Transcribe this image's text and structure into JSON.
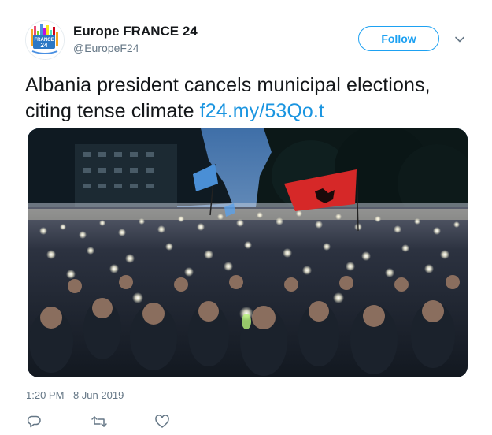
{
  "author": {
    "name": "Europe FRANCE 24",
    "handle": "@EuropeF24",
    "avatar_text_1": "FRANCE",
    "avatar_text_2": "24",
    "avatar_icon": "france24-europe-logo"
  },
  "header": {
    "follow_label": "Follow",
    "menu_icon": "chevron-down-icon"
  },
  "tweet": {
    "text": "Albania president cancels municipal elections, citing tense climate ",
    "link": "f24.my/53Qo.t",
    "media_description_icon": "photo"
  },
  "meta": {
    "timestamp": "1:20 PM - 8 Jun 2019"
  },
  "actions": {
    "reply_icon": "reply-icon",
    "retweet_icon": "retweet-icon",
    "like_icon": "heart-icon"
  },
  "colors": {
    "accent": "#1da1f2",
    "link": "#1b95e0",
    "muted": "#657786",
    "text": "#14171a",
    "flag_red": "#d62828",
    "flag_blue": "#4a8fd6"
  }
}
